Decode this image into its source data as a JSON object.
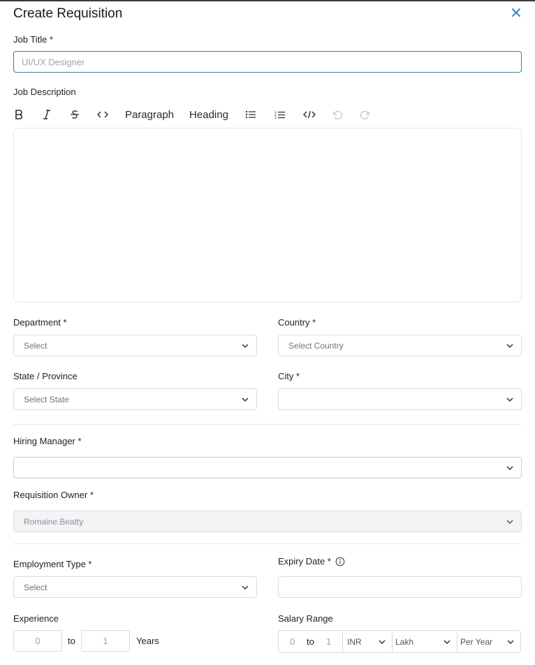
{
  "page": {
    "title": "Create Requisition"
  },
  "job_title": {
    "label": "Job Title *",
    "placeholder": "UI/UX Designer"
  },
  "job_description": {
    "label": "Job Description",
    "toolbar": {
      "paragraph": "Paragraph",
      "heading": "Heading"
    }
  },
  "department": {
    "label": "Department *",
    "value": "Select"
  },
  "country": {
    "label": "Country *",
    "value": "Select Country"
  },
  "state": {
    "label": "State / Province",
    "value": "Select State"
  },
  "city": {
    "label": "City *",
    "value": ""
  },
  "hiring_manager": {
    "label": "Hiring Manager *",
    "value": ""
  },
  "requisition_owner": {
    "label": "Requisition Owner *",
    "value": "Romaine.Beatty"
  },
  "employment_type": {
    "label": "Employment Type *",
    "value": "Select"
  },
  "expiry_date": {
    "label": "Expiry Date *",
    "value": ""
  },
  "experience": {
    "label": "Experience",
    "min": "0",
    "to": "to",
    "max": "1",
    "unit": "Years"
  },
  "salary": {
    "label": "Salary Range",
    "min": "0",
    "to": "to",
    "max": "1",
    "currency": "INR",
    "scale": "Lakh",
    "period": "Per Year"
  }
}
